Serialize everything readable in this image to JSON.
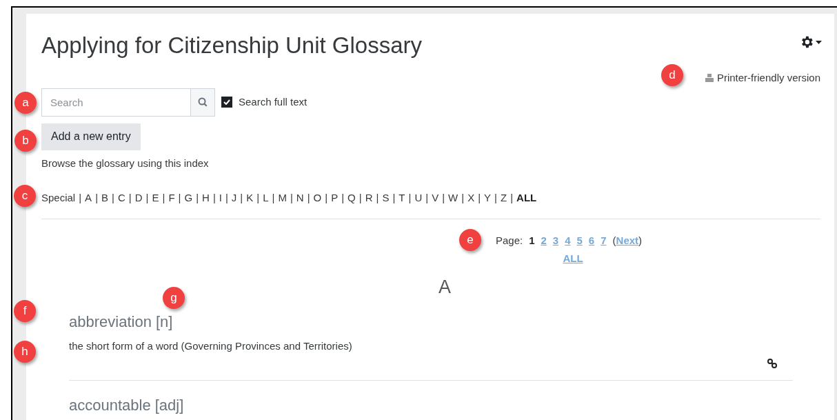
{
  "title": "Applying for Citizenship Unit Glossary",
  "printer_link": {
    "label": "Printer-friendly version"
  },
  "search": {
    "placeholder": "Search"
  },
  "search_full_text": {
    "label": "Search full text",
    "checked": true
  },
  "add_button": {
    "label": "Add a new entry"
  },
  "browse_label": "Browse the glossary using this index",
  "index": {
    "separator": "|",
    "letters": [
      {
        "label": "Special",
        "selected": false
      },
      {
        "label": "A",
        "selected": false
      },
      {
        "label": "B",
        "selected": false
      },
      {
        "label": "C",
        "selected": false
      },
      {
        "label": "D",
        "selected": false
      },
      {
        "label": "E",
        "selected": false
      },
      {
        "label": "F",
        "selected": false
      },
      {
        "label": "G",
        "selected": false
      },
      {
        "label": "H",
        "selected": false
      },
      {
        "label": "I",
        "selected": false
      },
      {
        "label": "J",
        "selected": false
      },
      {
        "label": "K",
        "selected": false
      },
      {
        "label": "L",
        "selected": false
      },
      {
        "label": "M",
        "selected": false
      },
      {
        "label": "N",
        "selected": false
      },
      {
        "label": "O",
        "selected": false
      },
      {
        "label": "P",
        "selected": false
      },
      {
        "label": "Q",
        "selected": false
      },
      {
        "label": "R",
        "selected": false
      },
      {
        "label": "S",
        "selected": false
      },
      {
        "label": "T",
        "selected": false
      },
      {
        "label": "U",
        "selected": false
      },
      {
        "label": "V",
        "selected": false
      },
      {
        "label": "W",
        "selected": false
      },
      {
        "label": "X",
        "selected": false
      },
      {
        "label": "Y",
        "selected": false
      },
      {
        "label": "Z",
        "selected": false
      },
      {
        "label": "ALL",
        "selected": true
      }
    ]
  },
  "pagination": {
    "label": "Page:",
    "pages": [
      {
        "label": "1",
        "selected": true
      },
      {
        "label": "2",
        "selected": false
      },
      {
        "label": "3",
        "selected": false
      },
      {
        "label": "4",
        "selected": false
      },
      {
        "label": "5",
        "selected": false
      },
      {
        "label": "6",
        "selected": false
      },
      {
        "label": "7",
        "selected": false
      }
    ],
    "open": "(",
    "next": "Next",
    "close": ")",
    "all": "ALL"
  },
  "section_letter": "A",
  "entries": [
    {
      "term": "abbreviation [n]",
      "definition": "the short form of a word (Governing Provinces and Territories)"
    },
    {
      "term": "accountable [adj]"
    }
  ],
  "callouts": [
    {
      "label": "a"
    },
    {
      "label": "b"
    },
    {
      "label": "c"
    },
    {
      "label": "d"
    },
    {
      "label": "e"
    },
    {
      "label": "f"
    },
    {
      "label": "g"
    },
    {
      "label": "h"
    }
  ]
}
